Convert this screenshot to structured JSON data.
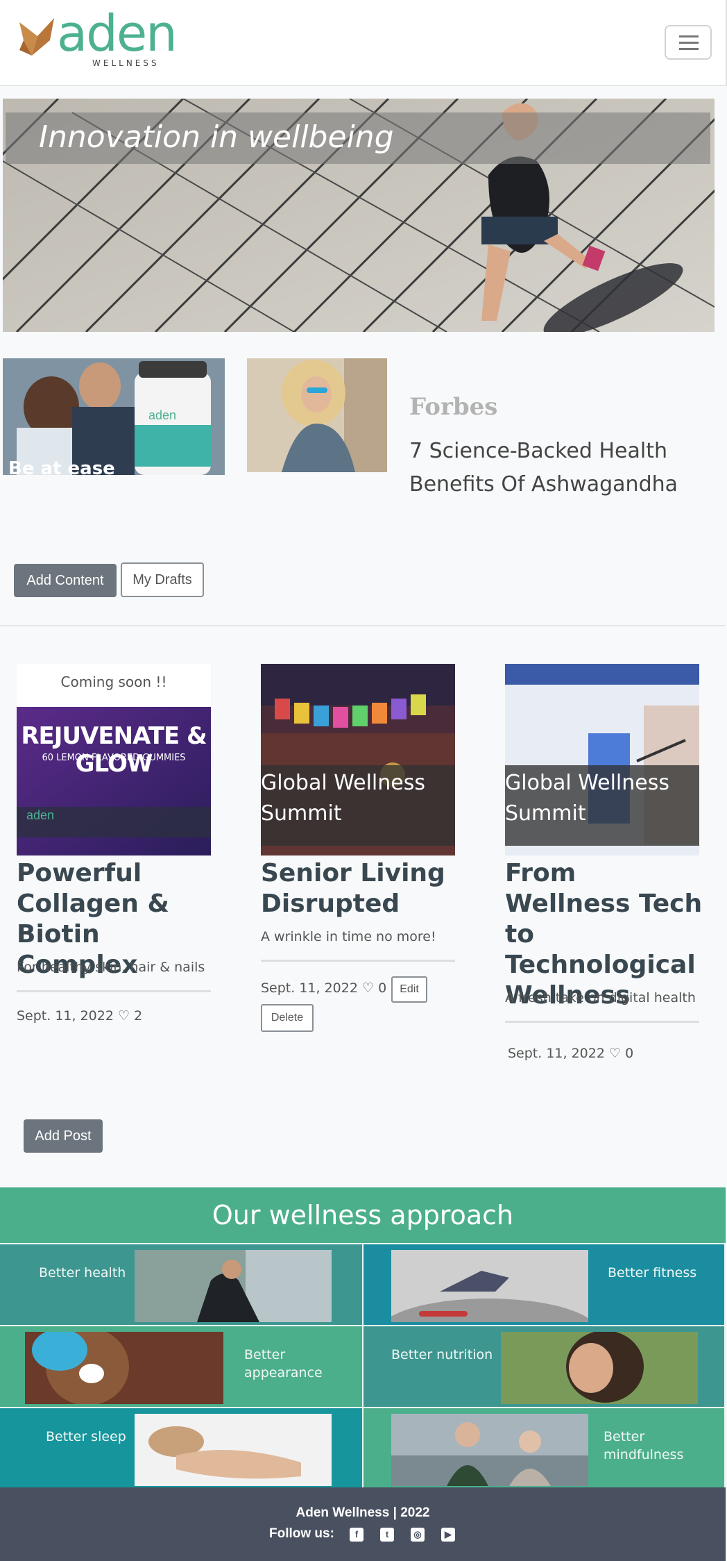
{
  "brand": {
    "name": "aden",
    "tagline": "WELLNESS",
    "accent": "#4db191"
  },
  "navbar": {
    "menu_icon": "hamburger-icon"
  },
  "hero": {
    "title": "Innovation in wellbeing"
  },
  "featured": {
    "tile1_caption": "Be at ease",
    "publisher": "Forbes",
    "title": "7 Science-Backed Health Benefits Of Ashwagandha"
  },
  "actions": {
    "add_content": "Add Content",
    "my_drafts": "My Drafts",
    "add_post": "Add Post"
  },
  "posts": [
    {
      "image_caption": "Coming soon !!",
      "product_text": "REJUVENATE & GLOW",
      "product_sub": "60 LEMON FLAVORED GUMMIES",
      "title": "Powerful Collagen & Biotin Complex",
      "subtitle": "For healthy skin, hair & nails",
      "date": "Sept. 11, 2022",
      "likes": "2"
    },
    {
      "overlay": "Global Wellness Summit",
      "title": "Senior Living Disrupted",
      "subtitle": "A wrinkle in time no more!",
      "date": "Sept. 11, 2022",
      "likes": "0",
      "separator": "-",
      "edit": "Edit",
      "delete": "Delete"
    },
    {
      "overlay": "Global Wellness Summit",
      "title": "From Wellness Tech to Technological Wellness",
      "subtitle": "A fresh take on digital health",
      "date": "Sept. 11, 2022",
      "likes": "0"
    }
  ],
  "approach": {
    "title": "Our wellness approach",
    "tiles": [
      {
        "label": "Better health"
      },
      {
        "label": "Better fitness"
      },
      {
        "label": "Better appearance"
      },
      {
        "label": "Better nutrition"
      },
      {
        "label": "Better sleep"
      },
      {
        "label": "Better mindfulness"
      }
    ]
  },
  "footer": {
    "brand": "Aden Wellness | 2022",
    "follow": "Follow us:",
    "social_icons": [
      "facebook-icon",
      "twitter-icon",
      "instagram-icon",
      "youtube-icon"
    ]
  }
}
